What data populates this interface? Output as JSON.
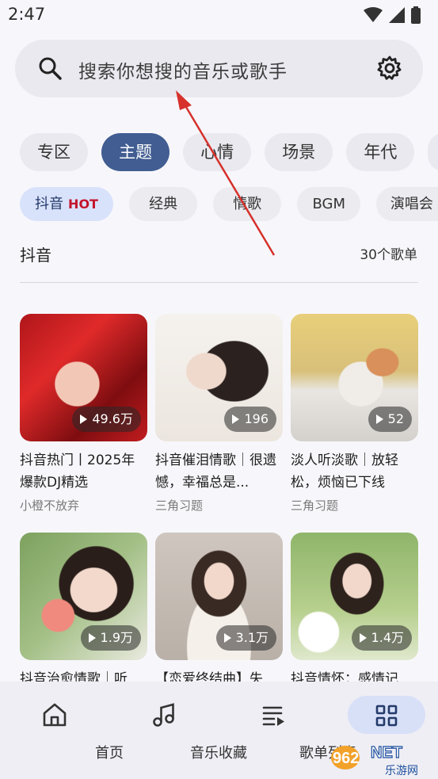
{
  "status_bar": {
    "time": "2:47"
  },
  "search": {
    "placeholder": "搜索你想搜的音乐或歌手"
  },
  "categories": [
    {
      "label": "专区",
      "active": false
    },
    {
      "label": "主题",
      "active": true
    },
    {
      "label": "心情",
      "active": false
    },
    {
      "label": "场景",
      "active": false
    },
    {
      "label": "年代",
      "active": false
    }
  ],
  "subtags": [
    {
      "label": "抖音",
      "badge": "HOT",
      "active": true
    },
    {
      "label": "经典"
    },
    {
      "label": "情歌"
    },
    {
      "label": "BGM"
    },
    {
      "label": "演唱会",
      "dot": true
    }
  ],
  "section": {
    "title": "抖音",
    "count": "30个歌单"
  },
  "playlists": [
    {
      "plays": "49.6万",
      "title": "抖音热门丨2025年爆款DJ精选",
      "author": "小橙不放弃"
    },
    {
      "plays": "196",
      "title": "抖音催泪情歌｜很遗憾，幸福总是...",
      "author": "三角习题"
    },
    {
      "plays": "52",
      "title": "淡人听淡歌｜放轻松，烦恼已下线",
      "author": "三角习题"
    },
    {
      "plays": "1.9万",
      "title": "抖音治愈情歌｜听",
      "author": ""
    },
    {
      "plays": "3.1万",
      "title": "【恋爱终结曲】失",
      "author": ""
    },
    {
      "plays": "1.4万",
      "title": "抖音情怀：感情记",
      "author": ""
    }
  ],
  "nav": [
    {
      "label": "首页",
      "icon": "home-icon"
    },
    {
      "label": "音乐收藏",
      "icon": "music-note-icon"
    },
    {
      "label": "歌单列表",
      "icon": "playlist-icon"
    },
    {
      "label": "",
      "icon": "grid-icon",
      "active": true
    }
  ],
  "watermark": {
    "text": "962 NET",
    "subtext": "乐游网"
  },
  "colors": {
    "accent": "#415d91",
    "hot": "#c3142c",
    "annotation": "#d6312b"
  }
}
